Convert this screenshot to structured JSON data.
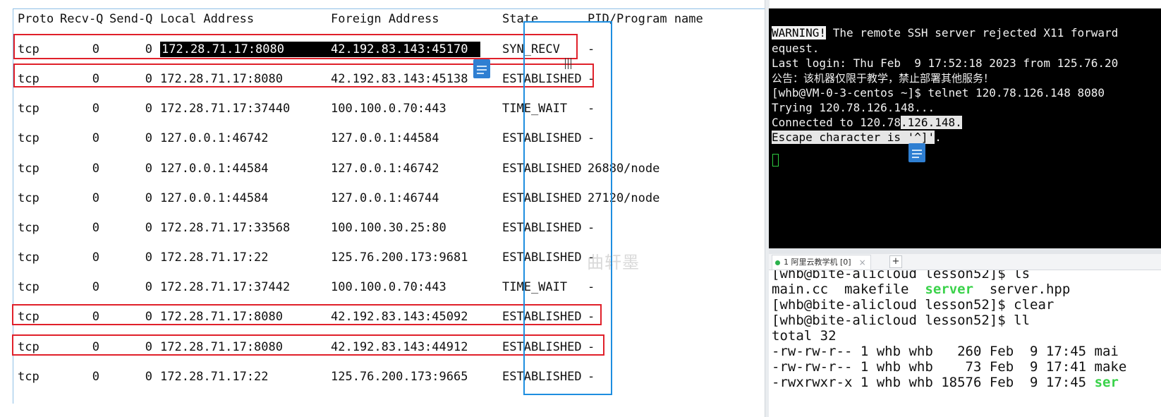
{
  "netstat": {
    "headers": {
      "proto": "Proto",
      "recvq": "Recv-Q",
      "sendq": "Send-Q",
      "local": "Local Address",
      "foreign": "Foreign Address",
      "state": "State",
      "pid": "PID/Program name"
    },
    "rows": [
      {
        "proto": "tcp",
        "recvq": "0",
        "sendq": "0",
        "local": "172.28.71.17:8080",
        "foreign": "42.192.83.143:45170",
        "state": "SYN_RECV",
        "pid": "-"
      },
      {
        "proto": "tcp",
        "recvq": "0",
        "sendq": "0",
        "local": "172.28.71.17:8080",
        "foreign": "42.192.83.143:45138",
        "state": "ESTABLISHED",
        "pid": "-"
      },
      {
        "proto": "tcp",
        "recvq": "0",
        "sendq": "0",
        "local": "172.28.71.17:37440",
        "foreign": "100.100.0.70:443",
        "state": "TIME_WAIT",
        "pid": "-"
      },
      {
        "proto": "tcp",
        "recvq": "0",
        "sendq": "0",
        "local": "127.0.0.1:46742",
        "foreign": "127.0.0.1:44584",
        "state": "ESTABLISHED",
        "pid": "-"
      },
      {
        "proto": "tcp",
        "recvq": "0",
        "sendq": "0",
        "local": "127.0.0.1:44584",
        "foreign": "127.0.0.1:46742",
        "state": "ESTABLISHED",
        "pid": "26880/node"
      },
      {
        "proto": "tcp",
        "recvq": "0",
        "sendq": "0",
        "local": "127.0.0.1:44584",
        "foreign": "127.0.0.1:46744",
        "state": "ESTABLISHED",
        "pid": "27120/node"
      },
      {
        "proto": "tcp",
        "recvq": "0",
        "sendq": "0",
        "local": "172.28.71.17:33568",
        "foreign": "100.100.30.25:80",
        "state": "ESTABLISHED",
        "pid": "-"
      },
      {
        "proto": "tcp",
        "recvq": "0",
        "sendq": "0",
        "local": "172.28.71.17:22",
        "foreign": "125.76.200.173:9681",
        "state": "ESTABLISHED",
        "pid": "-"
      },
      {
        "proto": "tcp",
        "recvq": "0",
        "sendq": "0",
        "local": "172.28.71.17:37442",
        "foreign": "100.100.0.70:443",
        "state": "TIME_WAIT",
        "pid": "-"
      },
      {
        "proto": "tcp",
        "recvq": "0",
        "sendq": "0",
        "local": "172.28.71.17:8080",
        "foreign": "42.192.83.143:45092",
        "state": "ESTABLISHED",
        "pid": "-"
      },
      {
        "proto": "tcp",
        "recvq": "0",
        "sendq": "0",
        "local": "172.28.71.17:8080",
        "foreign": "42.192.83.143:44912",
        "state": "ESTABLISHED",
        "pid": "-"
      },
      {
        "proto": "tcp",
        "recvq": "0",
        "sendq": "0",
        "local": "172.28.71.17:22",
        "foreign": "125.76.200.173:9665",
        "state": "ESTABLISHED",
        "pid": "-"
      }
    ],
    "watermark": "曲轩墨"
  },
  "ssh_terminal": {
    "warning_tag": "WARNING!",
    "warning_rest": " The remote SSH server rejected X11 forward",
    "line2": "equest.",
    "line3": "Last login: Thu Feb  9 17:52:18 2023 from 125.76.20",
    "line4": "公告：该机器仅限于教学，禁止部署其他服务！",
    "line5": "[whb@VM-0-3-centos ~]$ telnet 120.78.126.148 8080",
    "line6": "Trying 120.78.126.148...",
    "line7a": "Connected to 120.78",
    "line7b": ".126.148.",
    "line8a": "Escape character is '^]'",
    "line8b": "."
  },
  "tab": {
    "label": "1 阿里云教学机 [0]",
    "close": "×",
    "add": "+"
  },
  "local_terminal": {
    "lines": [
      "[whb@bite-alicloud lesson52]$ ls",
      "[whb@bite-alicloud lesson52]$ clear",
      "[whb@bite-alicloud lesson52]$ ll",
      "total 32",
      "-rw-rw-r-- 1 whb whb   260 Feb  9 17:45 mai",
      "-rw-rw-r-- 1 whb whb    73 Feb  9 17:41 make",
      "-rwxrwxr-x 1 whb whb 18576 Feb  9 17:45 "
    ],
    "ls_files": [
      "main.cc",
      "makefile",
      "server",
      "server.hpp"
    ],
    "last_line_colored": "ser",
    "colors": {
      "executable": "#3ad24a"
    }
  },
  "colors": {
    "highlight_box": "#e0202a",
    "state_box": "#1e8ee0",
    "terminal_bg": "#000000"
  }
}
